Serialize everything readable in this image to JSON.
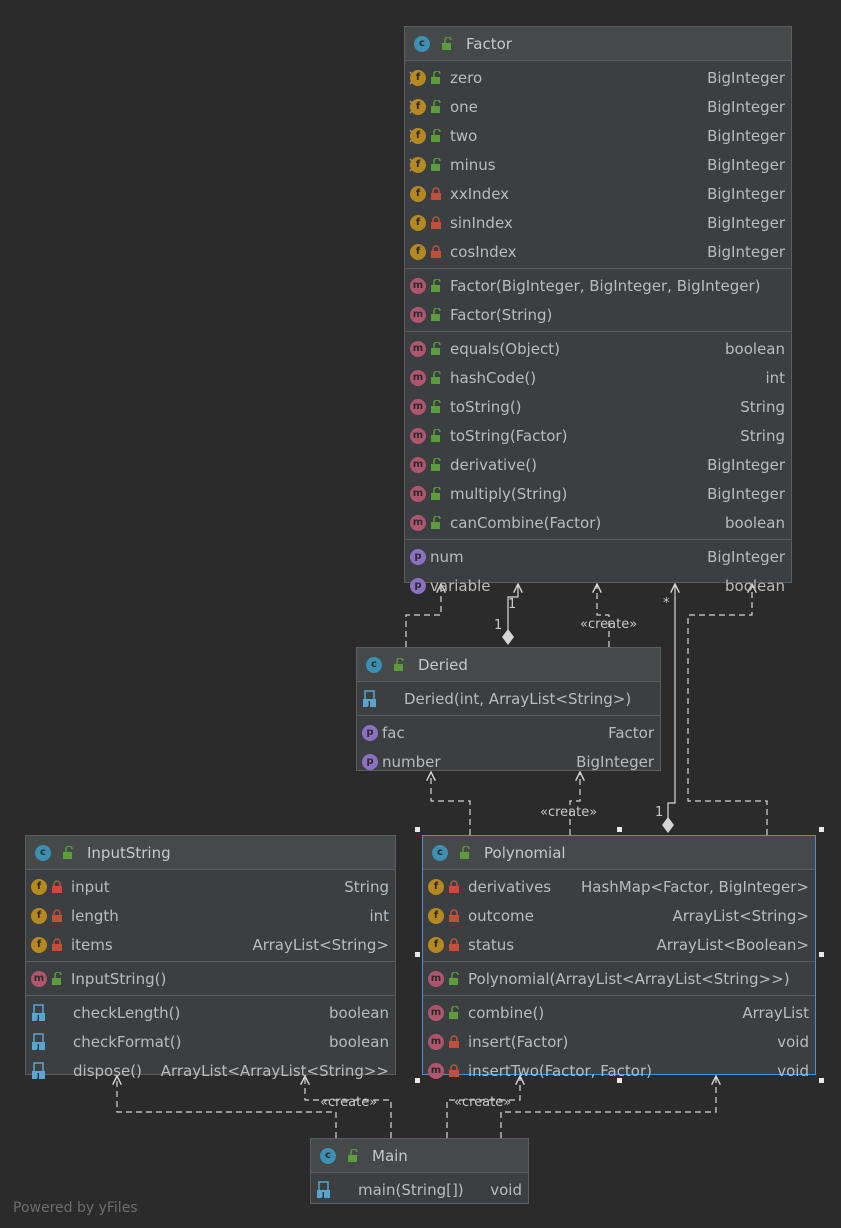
{
  "classes": {
    "factor": {
      "name": "Factor",
      "fields": [
        {
          "name": "zero",
          "type": "BigInteger"
        },
        {
          "name": "one",
          "type": "BigInteger"
        },
        {
          "name": "two",
          "type": "BigInteger"
        },
        {
          "name": "minus",
          "type": "BigInteger"
        },
        {
          "name": "xxIndex",
          "type": "BigInteger"
        },
        {
          "name": "sinIndex",
          "type": "BigInteger"
        },
        {
          "name": "cosIndex",
          "type": "BigInteger"
        }
      ],
      "constructors": [
        {
          "name": "Factor(BigInteger, BigInteger, BigInteger)",
          "type": ""
        },
        {
          "name": "Factor(String)",
          "type": ""
        }
      ],
      "methods": [
        {
          "name": "equals(Object)",
          "type": "boolean"
        },
        {
          "name": "hashCode()",
          "type": "int"
        },
        {
          "name": "toString()",
          "type": "String"
        },
        {
          "name": "toString(Factor)",
          "type": "String"
        },
        {
          "name": "derivative()",
          "type": "BigInteger"
        },
        {
          "name": "multiply(String)",
          "type": "BigInteger"
        },
        {
          "name": "canCombine(Factor)",
          "type": "boolean"
        }
      ],
      "properties": [
        {
          "name": "num",
          "type": "BigInteger"
        },
        {
          "name": "variable",
          "type": "boolean"
        }
      ]
    },
    "deried": {
      "name": "Deried",
      "constructors": [
        {
          "name": "Deried(int, ArrayList<String>)",
          "type": ""
        }
      ],
      "properties": [
        {
          "name": "fac",
          "type": "Factor"
        },
        {
          "name": "number",
          "type": "BigInteger"
        }
      ]
    },
    "inputstring": {
      "name": "InputString",
      "fields": [
        {
          "name": "input",
          "type": "String"
        },
        {
          "name": "length",
          "type": "int"
        },
        {
          "name": "items",
          "type": "ArrayList<String>"
        }
      ],
      "constructors": [
        {
          "name": "InputString()",
          "type": ""
        }
      ],
      "static_methods": [
        {
          "name": "checkLength()",
          "type": "boolean"
        },
        {
          "name": "checkFormat()",
          "type": "boolean"
        },
        {
          "name": "dispose()",
          "type": "ArrayList<ArrayList<String>>"
        }
      ]
    },
    "polynomial": {
      "name": "Polynomial",
      "fields": [
        {
          "name": "derivatives",
          "type": "HashMap<Factor, BigInteger>"
        },
        {
          "name": "outcome",
          "type": "ArrayList<String>"
        },
        {
          "name": "status",
          "type": "ArrayList<Boolean>"
        }
      ],
      "constructors": [
        {
          "name": "Polynomial(ArrayList<ArrayList<String>>)",
          "type": ""
        }
      ],
      "methods": [
        {
          "name": "combine()",
          "type": "ArrayList",
          "vis": "public"
        },
        {
          "name": "insert(Factor)",
          "type": "void",
          "vis": "private"
        },
        {
          "name": "insertTwo(Factor, Factor)",
          "type": "void",
          "vis": "private"
        }
      ]
    },
    "main": {
      "name": "Main",
      "static_methods": [
        {
          "name": "main(String[])",
          "type": "void"
        }
      ]
    }
  },
  "edge_labels": {
    "create1": "«create»",
    "create2": "«create»",
    "create3": "«create»",
    "create4": "«create»",
    "mult_one_a": "1",
    "mult_one_b": "1",
    "mult_one_c": "1",
    "mult_many": "*"
  },
  "footer": "Powered by yFiles",
  "icons": {
    "class": "class-icon",
    "field": "field-icon",
    "method": "method-icon",
    "property": "property-icon",
    "static_method": "static-method-icon",
    "public": "unlocked-icon",
    "private": "locked-icon"
  },
  "colors": {
    "background": "#2b2b2b",
    "panel": "#3c3f41",
    "header": "#45494a",
    "border": "#5d5d5d",
    "selection": "#4b8fd8",
    "text": "#bbbbbb",
    "edge": "#d6d6d6",
    "public": "#5c9c3d",
    "private": "#c0503a"
  }
}
